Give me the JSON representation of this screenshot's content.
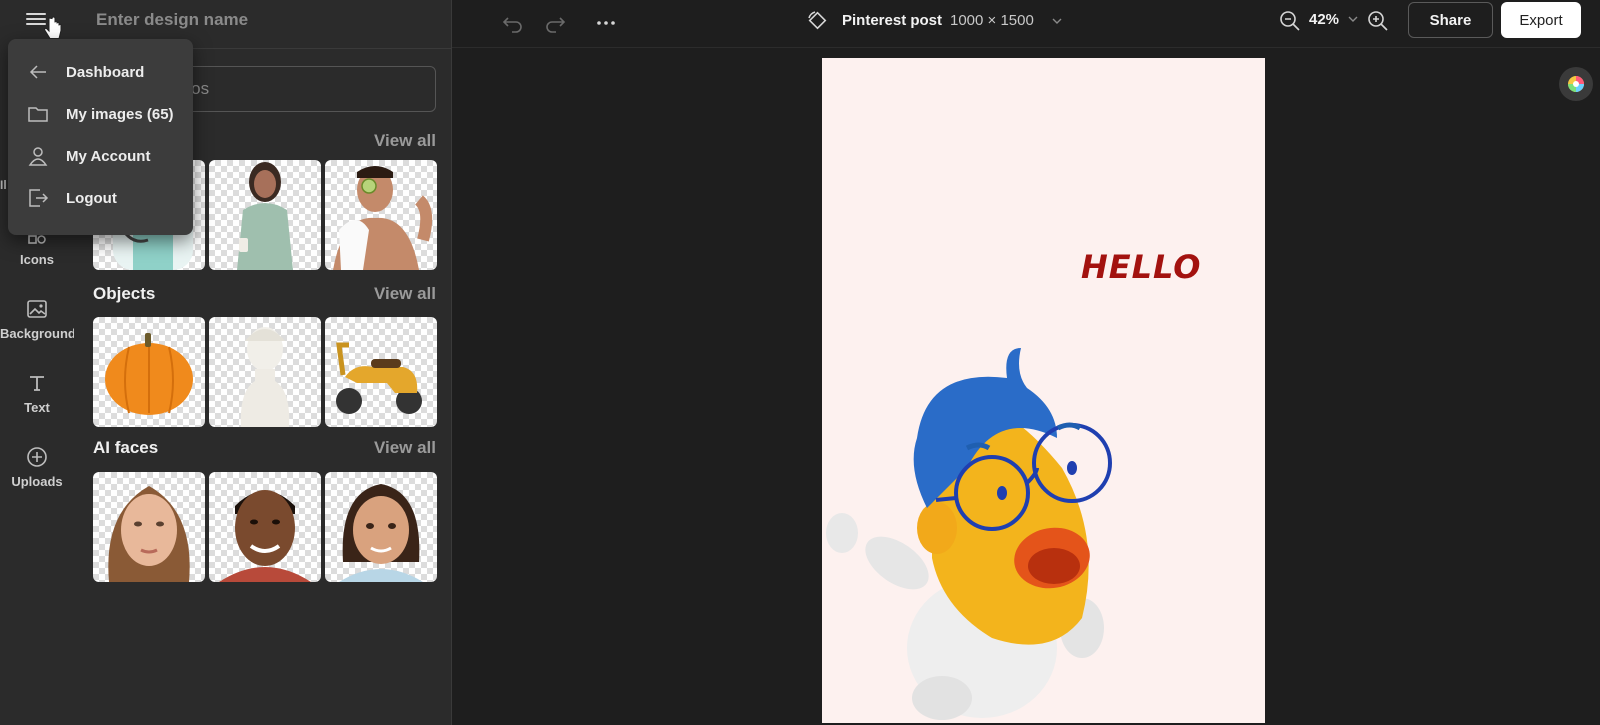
{
  "app": {
    "design_name_placeholder": "Enter design name"
  },
  "rail": {
    "items": [
      {
        "label": "Icons",
        "icon": "shapes-icon"
      },
      {
        "label": "Backgrounds",
        "icon": "image-icon"
      },
      {
        "label": "Text",
        "icon": "text-icon"
      },
      {
        "label": "Uploads",
        "icon": "plus-circle-icon"
      }
    ],
    "partial_label": "Il"
  },
  "menu": {
    "items": [
      {
        "label": "Dashboard",
        "icon": "arrow-left-icon"
      },
      {
        "label": "My images (65)",
        "icon": "folder-icon"
      },
      {
        "label": "My Account",
        "icon": "user-icon"
      },
      {
        "label": "Logout",
        "icon": "logout-icon"
      }
    ]
  },
  "panel": {
    "search_placeholder_visible": "otos",
    "view_all_label": "View all",
    "sections": [
      {
        "title": "",
        "thumbs": [
          "doctor",
          "woman-with-coffee",
          "man-with-cucumber"
        ]
      },
      {
        "title": "Objects",
        "thumbs": [
          "pumpkin",
          "bust-statue",
          "scooter"
        ]
      },
      {
        "title": "AI faces",
        "thumbs": [
          "woman-face",
          "man-face",
          "girl-face"
        ]
      }
    ]
  },
  "toolbar": {
    "doc_title": "Pinterest post",
    "doc_size": "1000 × 1500",
    "zoom": "42%",
    "share_label": "Share",
    "export_label": "Export"
  },
  "canvas": {
    "headline": "HELLO",
    "background_color": "#fdf1ef",
    "headline_color": "#a3120f"
  }
}
